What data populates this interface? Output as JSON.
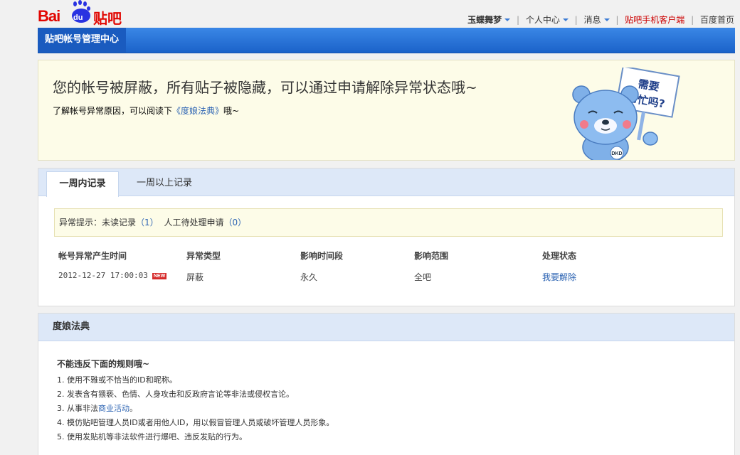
{
  "logo": {
    "bai": "Bai",
    "du": "du",
    "tieba": "贴吧"
  },
  "topnav": {
    "username": "玉蝶舞梦",
    "personal_center": "个人中心",
    "messages": "消息",
    "mobile_client": "贴吧手机客户端",
    "baidu_home": "百度首页"
  },
  "header": {
    "title": "贴吧帐号管理中心"
  },
  "notice": {
    "headline": "您的帐号被屏蔽，所有贴子被隐藏，可以通过申请解除异常状态哦~",
    "prefix": "了解帐号异常原因，可以阅读下",
    "link": "《度娘法典》",
    "suffix": "哦~",
    "sign_text_line1": "需要",
    "sign_text_line2": "帮忙吗?",
    "bear_badge": "DKD"
  },
  "records": {
    "tabs": [
      {
        "label": "一周内记录",
        "active": true
      },
      {
        "label": "一周以上记录",
        "active": false
      }
    ],
    "hint": {
      "label": "异常提示：未读记录",
      "unread": "（1）",
      "pending_label": "人工待处理申请",
      "pending": "（0）"
    },
    "columns": [
      "帐号异常产生时间",
      "异常类型",
      "影响时间段",
      "影响范围",
      "处理状态"
    ],
    "rows": [
      {
        "time": "2012-12-27 17:00:03",
        "badge": "NEW",
        "type": "屏蔽",
        "period": "永久",
        "scope": "全吧",
        "status": "我要解除"
      }
    ]
  },
  "rules": {
    "title": "度娘法典",
    "subtitle": "不能违反下面的规则哦~",
    "items": [
      {
        "text": "1. 使用不雅或不恰当的ID和昵称。"
      },
      {
        "before": "3. 从事非法",
        "link": "商业活动",
        "after": "。"
      },
      {
        "text": "2. 发表含有猥亵、色情、人身攻击和反政府言论等非法或侵权言论。"
      },
      {
        "text": "4. 模仿贴吧管理人员ID或者用他人ID，用以假冒管理人员或破坏管理人员形象。"
      },
      {
        "text": "5. 使用发贴机等非法软件进行爆吧、违反发贴的行为。"
      }
    ]
  },
  "colors": {
    "brand_red": "#e10601",
    "brand_blue": "#2932e1",
    "header_blue": "#1b62c9",
    "link_blue": "#2d64b3",
    "notice_bg": "#fdfce8",
    "tab_bg": "#dde8f8"
  }
}
